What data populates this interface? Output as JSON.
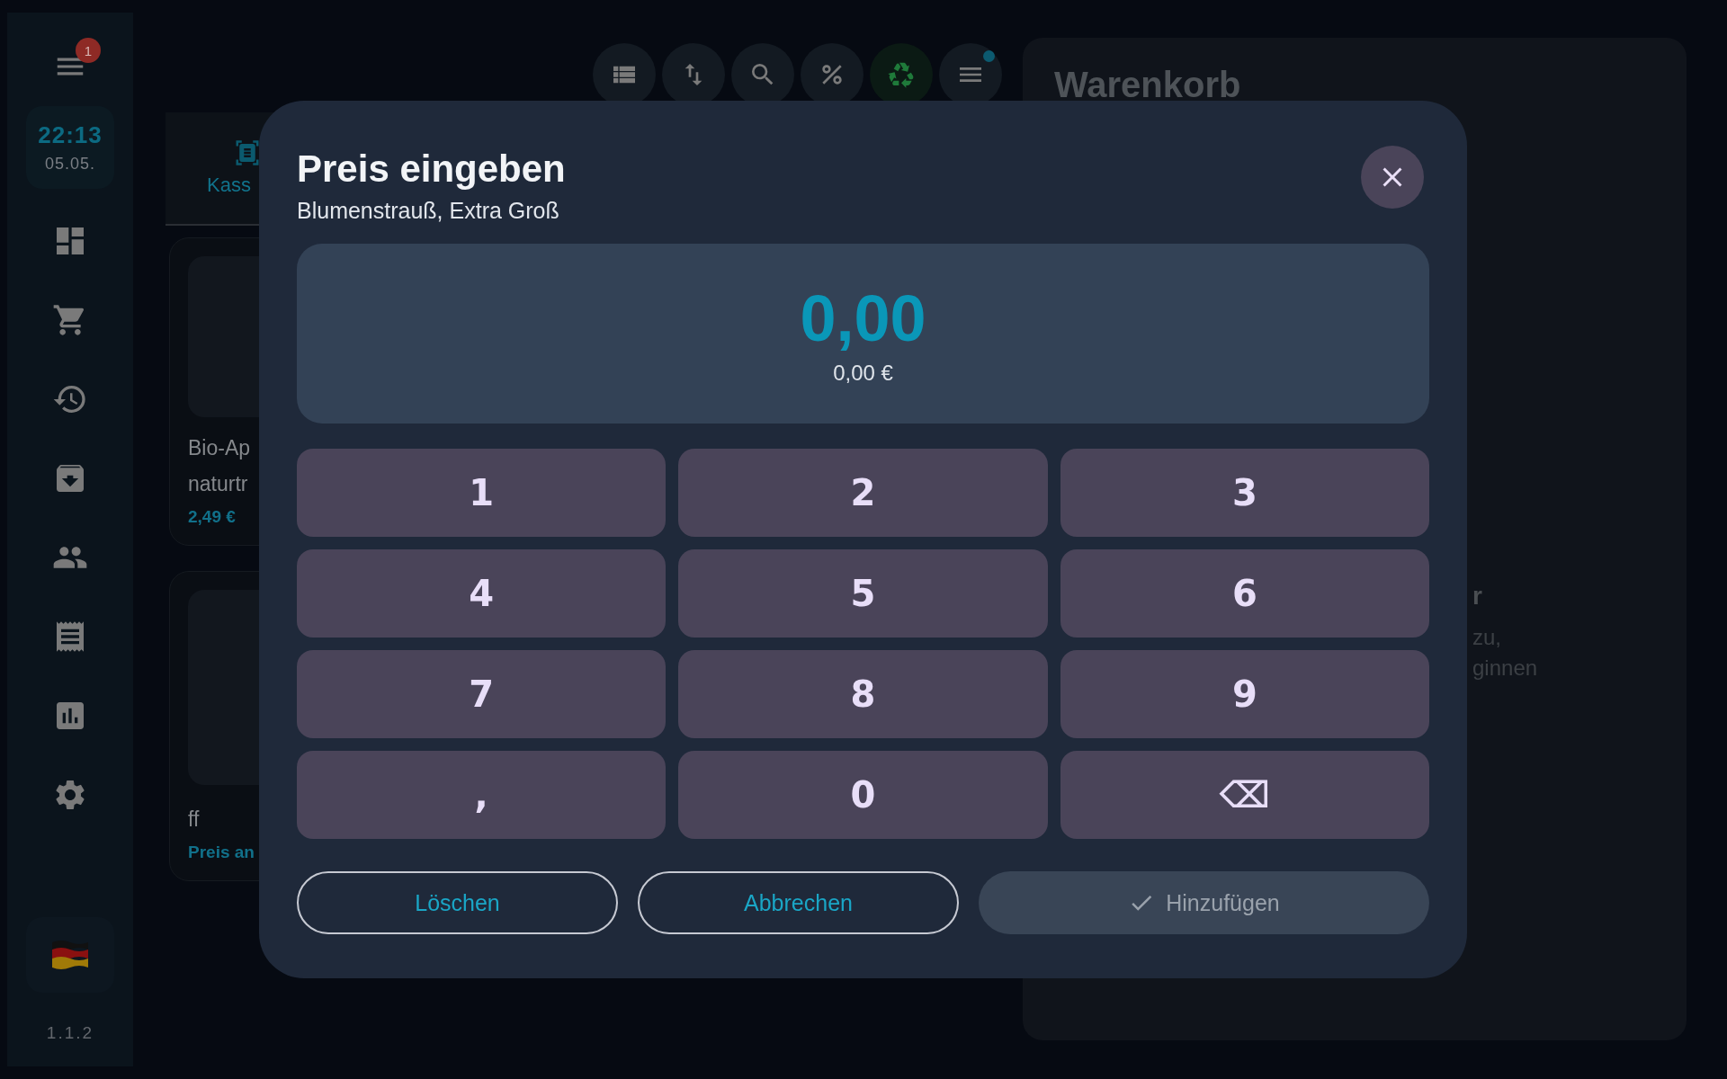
{
  "sidebar": {
    "menu_badge": "1",
    "time": "22:13",
    "date": "05.05.",
    "version": "1.1.2"
  },
  "toolbar": [
    {
      "selected": false,
      "dot": false
    },
    {
      "selected": false,
      "dot": false
    },
    {
      "selected": false,
      "dot": false
    },
    {
      "selected": false,
      "dot": false
    },
    {
      "selected": true,
      "dot": false
    },
    {
      "selected": false,
      "dot": true
    }
  ],
  "tab": {
    "label": "Kass"
  },
  "products": [
    {
      "name_lines": [
        "Bio-Ap",
        "naturtr"
      ],
      "price": "2,49 €"
    },
    {
      "name_lines": [
        "ff"
      ],
      "price": "Preis an"
    }
  ],
  "cart": {
    "title": "Warenkorb",
    "empty_lines": [
      "r",
      "zu,",
      "ginnen"
    ]
  },
  "dialog": {
    "title": "Preis eingeben",
    "subtitle": "Blumenstrauß, Extra Groß",
    "value": "0,00",
    "amount": "0,00 €",
    "keys": [
      "1",
      "2",
      "3",
      "4",
      "5",
      "6",
      "7",
      "8",
      "9",
      ",",
      "0",
      "⌫"
    ],
    "buttons": [
      {
        "label": "Löschen",
        "kind": "outline",
        "disabled": false
      },
      {
        "label": "Abbrechen",
        "kind": "outline",
        "disabled": false
      },
      {
        "label": "Hinzufügen",
        "kind": "confirm",
        "disabled": true
      }
    ]
  }
}
